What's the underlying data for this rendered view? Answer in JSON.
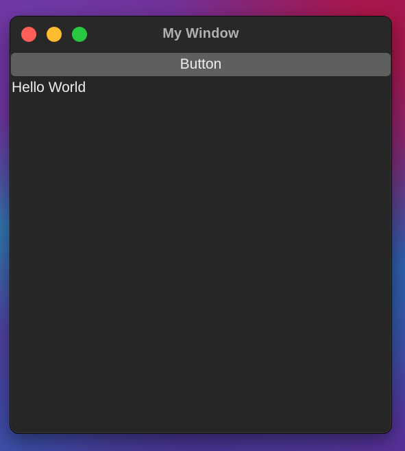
{
  "window": {
    "title": "My Window",
    "controls": {
      "close_color": "#ff5f57",
      "minimize_color": "#febc2e",
      "maximize_color": "#28c840"
    }
  },
  "content": {
    "button_label": "Button",
    "text_label": "Hello World"
  },
  "colors": {
    "window_background": "#262626",
    "button_background": "#5f5f5f",
    "text": "#ededed"
  }
}
